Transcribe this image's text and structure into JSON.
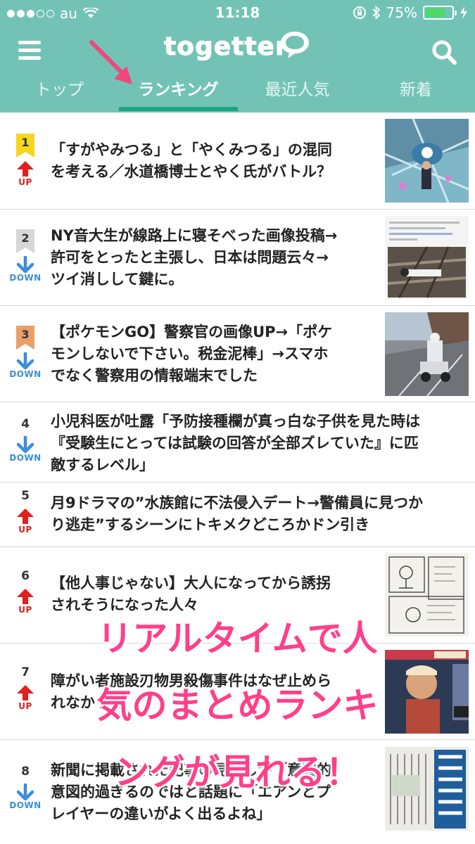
{
  "status_bar": {
    "carrier": "au",
    "time": "11:18",
    "battery": "75%",
    "battery_level": 0.75
  },
  "header": {
    "logo": "togetter",
    "tabs": [
      {
        "label": "トップ"
      },
      {
        "label": "ランキング",
        "active": true
      },
      {
        "label": "最近人気"
      },
      {
        "label": "新着"
      }
    ]
  },
  "rankings": [
    {
      "rank": "1",
      "direction": "UP",
      "title_lines": [
        "「すがやみつる」と「やくみつる」の混同",
        "を考える／水道橋博士とやく氏がバトル？"
      ],
      "badge_color": "#f7d51d"
    },
    {
      "rank": "2",
      "direction": "DOWN",
      "title_lines": [
        "NY音大生が線路上に寝そべった画像投稿→",
        "許可をとったと主張し、日本は問題云々→",
        "ツイ消しして鍵に。"
      ],
      "badge_color": "#d7d7d7"
    },
    {
      "rank": "3",
      "direction": "DOWN",
      "title_lines": [
        "【ポケモンGO】警察官の画像UP→「ポケ",
        "モンしないで下さい。税金泥棒」→スマホ",
        "でなく警察用の情報端末でした"
      ],
      "badge_color": "#e8a06a"
    },
    {
      "rank": "4",
      "direction": "DOWN",
      "title_lines": [
        "小児科医が吐露「予防接種欄が真っ白な子供を見た時は",
        "『受験生にとっては試験の回答が全部ズレていた』に匹",
        "敵するレベル」"
      ]
    },
    {
      "rank": "5",
      "direction": "UP",
      "title_lines": [
        "月9ドラマの”水族館に不法侵入デート→警備員に見つか",
        "り逃走”するシーンにトキメクどころかドン引き"
      ]
    },
    {
      "rank": "6",
      "direction": "UP",
      "title_lines": [
        "【他人事じゃない】大人になってから誘拐",
        "されそうになった人々"
      ]
    },
    {
      "rank": "7",
      "direction": "UP",
      "title_lines": [
        "障がい者施設刃物男殺傷事件はなぜ止めら",
        "れなかった"
      ]
    },
    {
      "rank": "8",
      "direction": "DOWN",
      "title_lines": [
        "新聞に掲載された記事の見出しが「意図的",
        "意図的過ぎるのではと話題に「エアンとプ",
        "レイヤーの違いがよく出るよね」"
      ]
    }
  ],
  "overlay_lines": [
    "リアルタイムで人",
    "気のまとめランキ",
    "ングが見れる！"
  ],
  "colors": {
    "header_bg": "#72c3b6",
    "tab_underline": "#1aa57f",
    "up": "#e02020",
    "down": "#3a8fd9",
    "overlay": "#ff3f8a",
    "pointer": "#f0477f"
  }
}
